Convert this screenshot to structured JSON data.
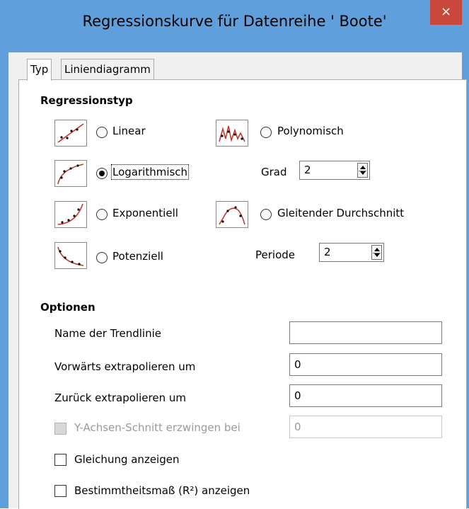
{
  "window": {
    "title": "Regressionskurve für Datenreihe ' Boote'",
    "close_glyph": "×"
  },
  "tabs": [
    {
      "label": "Typ"
    },
    {
      "label": "Liniendiagramm"
    }
  ],
  "regression": {
    "heading": "Regressionstyp",
    "linear": "Linear",
    "logarithmic": "Logarithmisch",
    "exponential": "Exponentiell",
    "power": "Potenziell",
    "polynomial": "Polynomisch",
    "moving_average": "Gleitender Durchschnitt",
    "degree_label": "Grad",
    "degree_value": "2",
    "period_label": "Periode",
    "period_value": "2",
    "selected": "Logarithmisch"
  },
  "options": {
    "heading": "Optionen",
    "trendline_name_label": "Name der Trendlinie",
    "trendline_name_value": "",
    "forward_label": "Vorwärts extrapolieren um",
    "forward_value": "0",
    "backward_label": "Zurück extrapolieren um",
    "backward_value": "0",
    "intercept_label": "Y-Achsen-Schnitt erzwingen bei",
    "intercept_value": "0",
    "equation_label": "Gleichung anzeigen",
    "r2_label": "Bestimmtheitsmaß (R²) anzeigen"
  },
  "colors": {
    "titlebar": "#5fa0dc",
    "close": "#c9483b",
    "curve": "#c0392b"
  }
}
